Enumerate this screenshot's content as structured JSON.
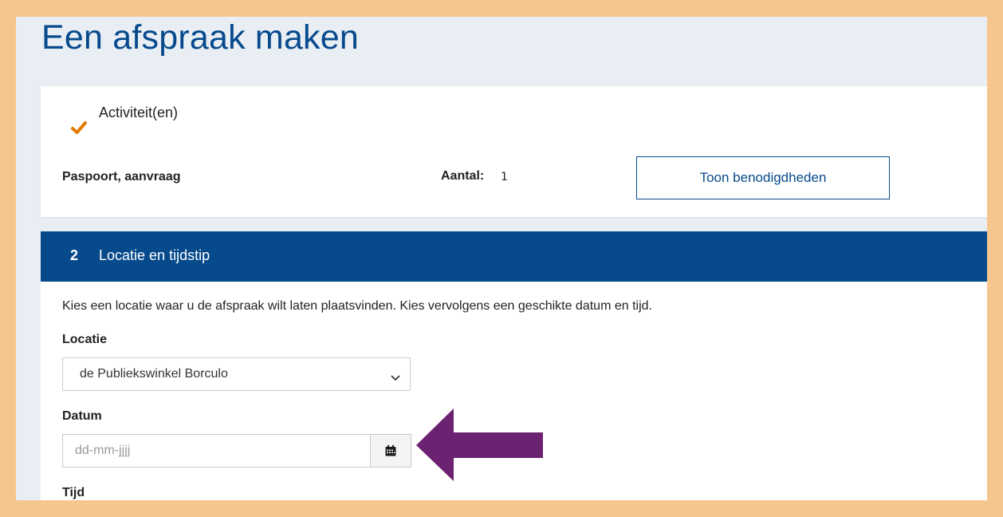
{
  "page": {
    "title": "Een afspraak maken"
  },
  "activities": {
    "heading": "Activiteit(en)",
    "item_name": "Paspoort, aanvraag",
    "count_label": "Aantal:",
    "count_value": "1",
    "show_button_label": "Toon benodigdheden"
  },
  "step2": {
    "number": "2",
    "title": "Locatie en tijdstip",
    "intro": "Kies een locatie waar u de afspraak wilt laten plaatsvinden. Kies vervolgens een geschikte datum en tijd.",
    "location_label": "Locatie",
    "location_selected": "de Publiekswinkel Borculo",
    "date_label": "Datum",
    "date_placeholder": "dd-mm-jjjj",
    "time_label": "Tijd"
  },
  "colors": {
    "primary": "#064a8c",
    "check": "#e07b00",
    "annotation_arrow": "#6b2270",
    "frame_border": "#f6c68f"
  },
  "icons": {
    "check": "check-icon",
    "dropdown": "chevron-down-icon",
    "calendar": "calendar-icon",
    "annotation": "arrow-left-icon"
  }
}
